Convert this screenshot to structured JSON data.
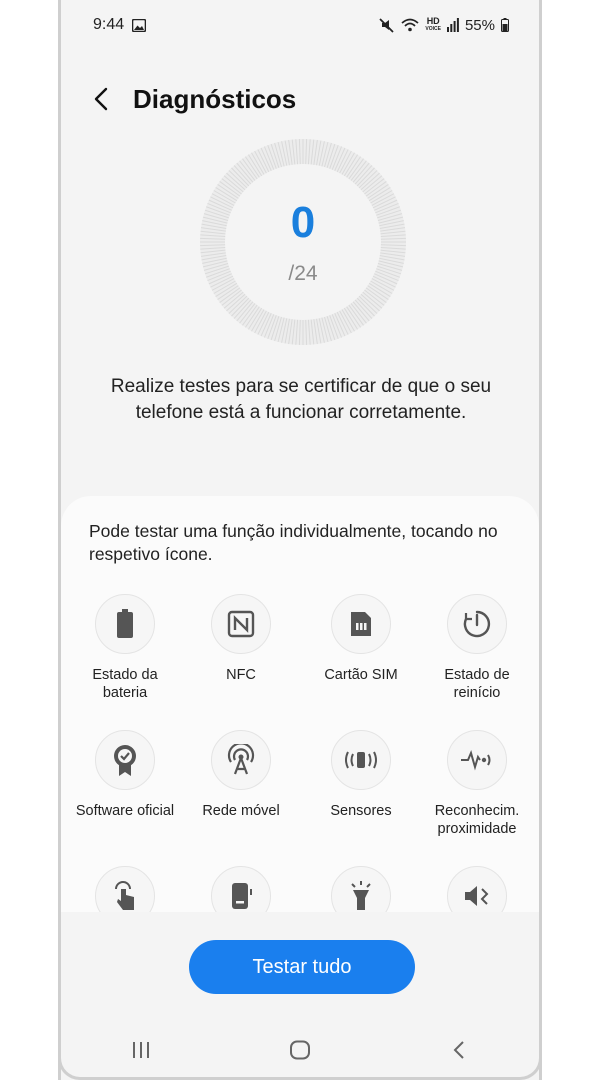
{
  "status_bar": {
    "time": "9:44",
    "battery": "55%",
    "hd_label": "HD",
    "voice_label": "VOICE"
  },
  "header": {
    "title": "Diagnósticos"
  },
  "progress": {
    "count": "0",
    "total": "/24"
  },
  "description": "Realize testes para se certificar de que o seu telefone está a funcionar corretamente.",
  "panel": {
    "instruction": "Pode testar uma função individualmente, tocando no respetivo ícone.",
    "tests": [
      {
        "label": "Estado da bateria",
        "icon": "battery-icon"
      },
      {
        "label": "NFC",
        "icon": "nfc-icon"
      },
      {
        "label": "Cartão SIM",
        "icon": "sim-card-icon"
      },
      {
        "label": "Estado de reinício",
        "icon": "restart-icon"
      },
      {
        "label": "Software oficial",
        "icon": "certified-badge-icon"
      },
      {
        "label": "Rede móvel",
        "icon": "cell-tower-icon"
      },
      {
        "label": "Sensores",
        "icon": "sensors-icon"
      },
      {
        "label": "Reconhecim. proximidade",
        "icon": "proximity-icon"
      },
      {
        "label": "",
        "icon": "touch-icon"
      },
      {
        "label": "",
        "icon": "screen-icon"
      },
      {
        "label": "",
        "icon": "flashlight-icon"
      },
      {
        "label": "",
        "icon": "speaker-icon"
      }
    ]
  },
  "actions": {
    "test_all": "Testar tudo"
  },
  "colors": {
    "accent": "#1a7fee",
    "count": "#1a7fdd"
  }
}
